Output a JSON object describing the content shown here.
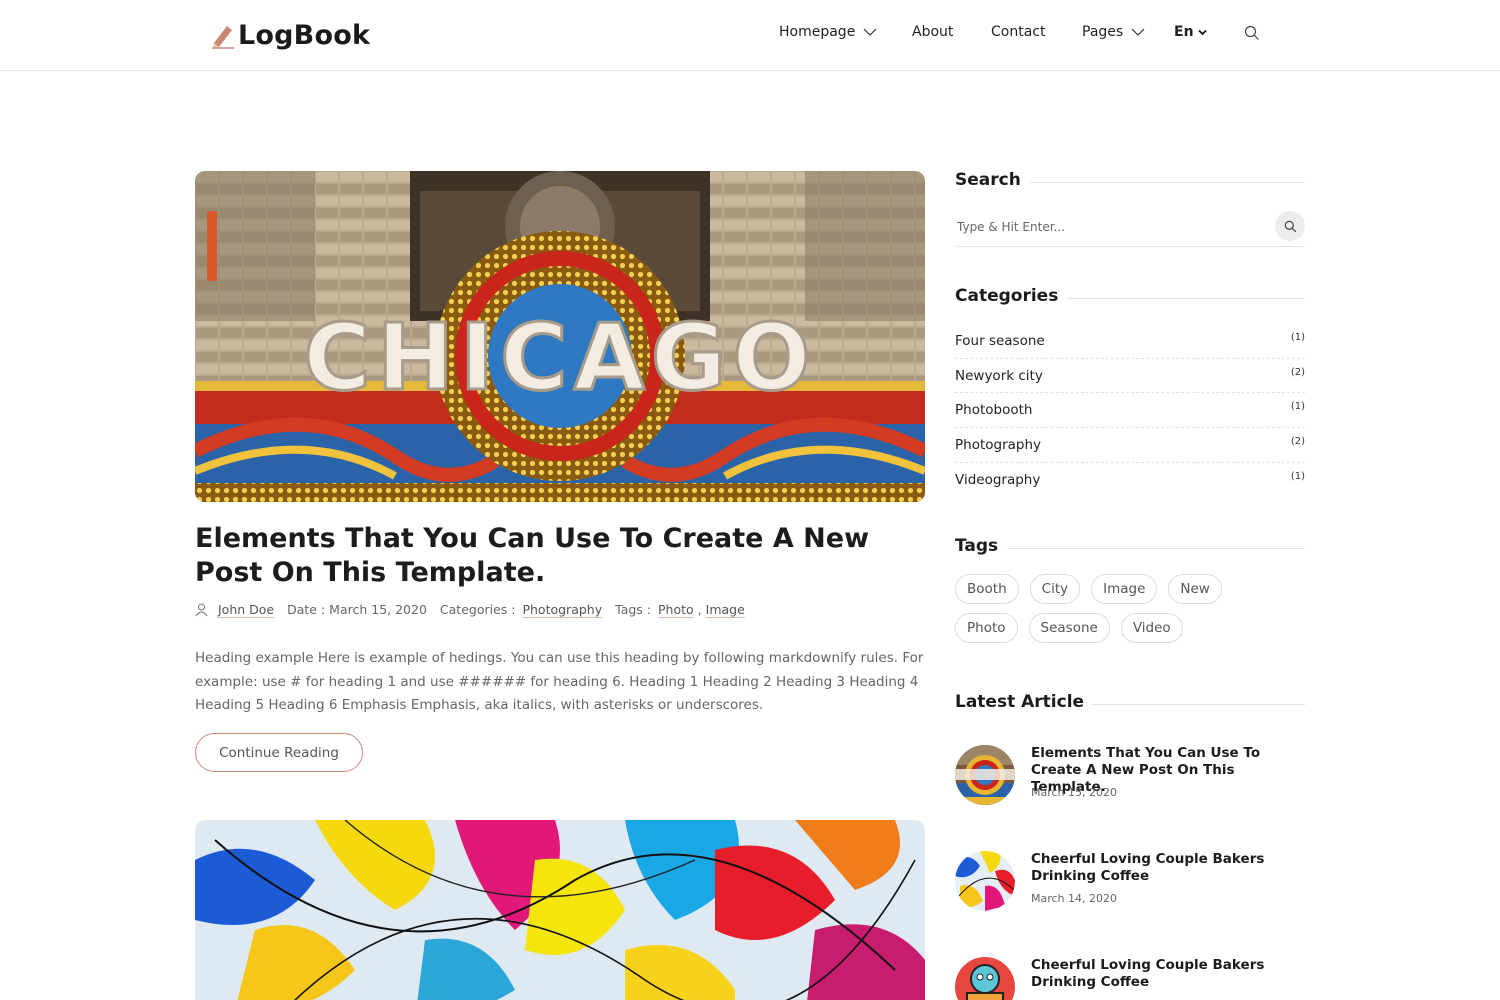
{
  "header": {
    "logo_text": "LogBook",
    "nav": {
      "homepage": "Homepage",
      "about": "About",
      "contact": "Contact",
      "pages": "Pages",
      "language": "En"
    }
  },
  "main": {
    "posts": [
      {
        "title": "Elements That You Can Use To Create A New Post On This Template.",
        "author": "John Doe",
        "date_label": "Date : March 15, 2020",
        "categories_label": "Categories :",
        "category": "Photography",
        "tags_label": "Tags :",
        "tag_1": "Photo",
        "tag_sep": ",",
        "tag_2": "Image",
        "excerpt": "Heading example Here is example of hedings. You can use this heading by following markdownify rules. For example: use # for heading 1 and use ###### for heading 6. Heading 1 Heading 2 Heading 3 Heading 4 Heading 5 Heading 6 Emphasis Emphasis, aka italics, with asterisks or underscores.",
        "continue_label": "Continue Reading",
        "image_sign_text": "CHICAGO"
      }
    ]
  },
  "sidebar": {
    "search": {
      "title": "Search",
      "placeholder": "Type & Hit Enter..."
    },
    "categories": {
      "title": "Categories",
      "items": [
        {
          "name": "Four seasone",
          "count": "(1)"
        },
        {
          "name": "Newyork city",
          "count": "(2)"
        },
        {
          "name": "Photobooth",
          "count": "(1)"
        },
        {
          "name": "Photography",
          "count": "(2)"
        },
        {
          "name": "Videography",
          "count": "(1)"
        }
      ]
    },
    "tags": {
      "title": "Tags",
      "items": [
        "Booth",
        "City",
        "Image",
        "New",
        "Photo",
        "Seasone",
        "Video"
      ]
    },
    "latest": {
      "title": "Latest Article",
      "items": [
        {
          "title": "Elements That You Can Use To Create A New Post On This Template.",
          "date": "March 15, 2020"
        },
        {
          "title": "Cheerful Loving Couple Bakers Drinking Coffee",
          "date": "March 14, 2020"
        },
        {
          "title": "Cheerful Loving Couple Bakers Drinking Coffee",
          "date": ""
        }
      ]
    }
  },
  "colors": {
    "accent": "#c98875",
    "text": "#1c1c1c",
    "muted": "#666666",
    "border": "#e2e2e2"
  }
}
